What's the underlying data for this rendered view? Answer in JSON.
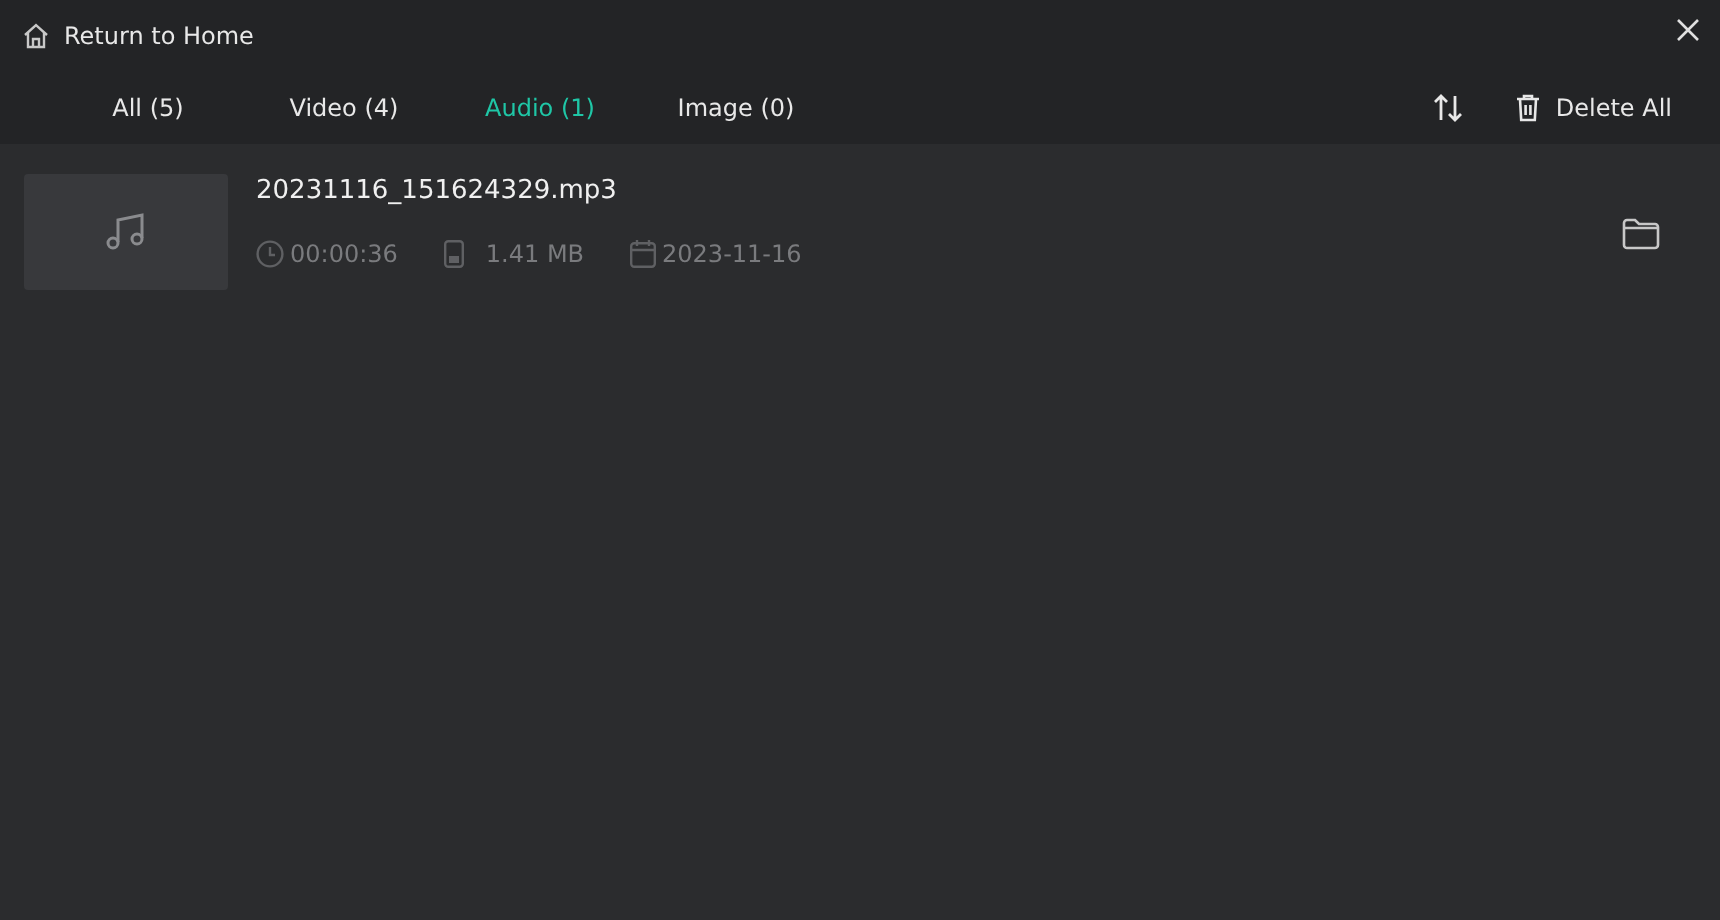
{
  "header": {
    "back_label": "Return to Home"
  },
  "tabs": [
    {
      "label": "All (5)",
      "selected": false
    },
    {
      "label": "Video (4)",
      "selected": false
    },
    {
      "label": "Audio (1)",
      "selected": true
    },
    {
      "label": "Image (0)",
      "selected": false
    }
  ],
  "toolbar": {
    "delete_label": "Delete All"
  },
  "files": [
    {
      "kind": "audio",
      "name": "20231116_151624329.mp3",
      "duration": "00:00:36",
      "size": "1.41 MB",
      "date": "2023-11-16"
    }
  ]
}
